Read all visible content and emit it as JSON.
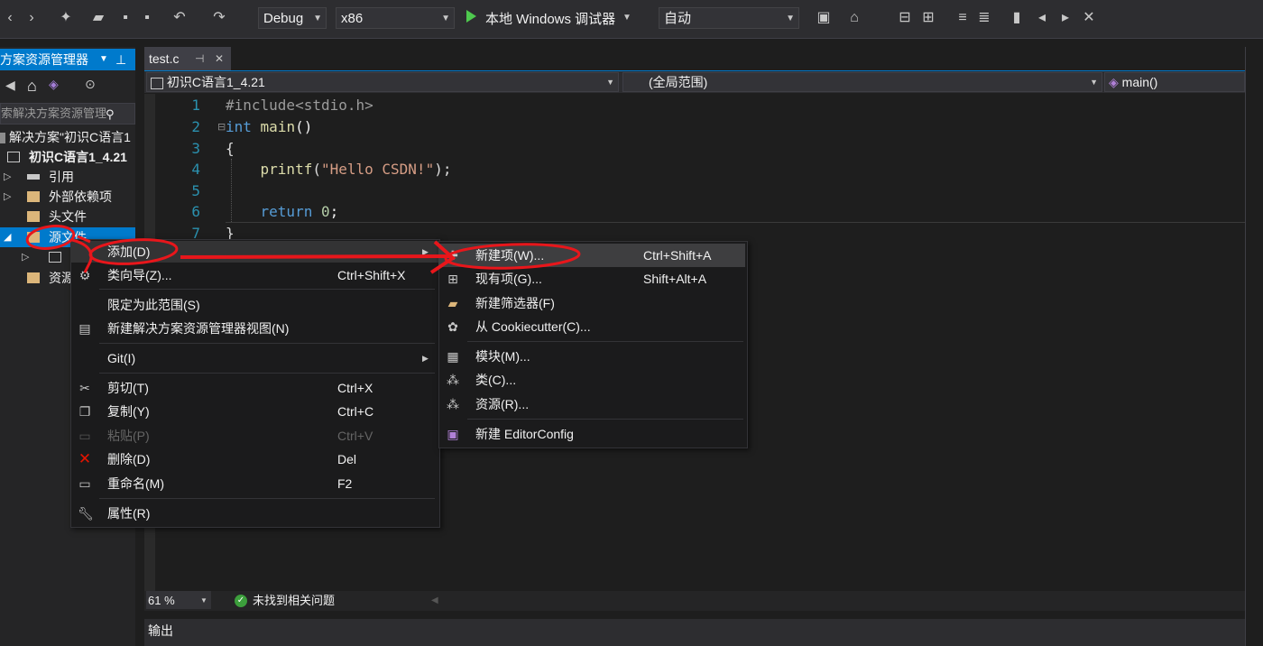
{
  "toolbar": {
    "config": "Debug",
    "platform": "x86",
    "run_label": "本地 Windows 调试器",
    "run_mode": "自动"
  },
  "solution_explorer": {
    "title": "方案资源管理器",
    "search_placeholder": "索解决方案资源管理",
    "items": [
      {
        "label": "解决方案\"初识C语言1"
      },
      {
        "label": "初识C语言1_4.21"
      },
      {
        "label": "引用"
      },
      {
        "label": "外部依赖项"
      },
      {
        "label": "头文件"
      },
      {
        "label": "源文件"
      },
      {
        "label": "资源"
      }
    ]
  },
  "editor": {
    "tab": "test.c",
    "nav_project": "初识C语言1_4.21",
    "nav_scope": "(全局范围)",
    "nav_member": "main()",
    "lines": [
      {
        "n": "1",
        "text": "#include<stdio.h>"
      },
      {
        "n": "2",
        "text": "int main()"
      },
      {
        "n": "3",
        "text": "{"
      },
      {
        "n": "4",
        "text": "    printf(\"Hello CSDN!\");"
      },
      {
        "n": "5",
        "text": ""
      },
      {
        "n": "6",
        "text": "    return 0;"
      },
      {
        "n": "7",
        "text": "}"
      }
    ],
    "zoom": "61 %",
    "status": "未找到相关问题",
    "output_tab": "输出"
  },
  "context_menu": {
    "items": [
      {
        "label": "添加(D)",
        "shortcut": ""
      },
      {
        "label": "类向导(Z)...",
        "shortcut": "Ctrl+Shift+X"
      },
      {
        "label": "限定为此范围(S)",
        "shortcut": ""
      },
      {
        "label": "新建解决方案资源管理器视图(N)",
        "shortcut": ""
      },
      {
        "label": "Git(I)",
        "shortcut": ""
      },
      {
        "label": "剪切(T)",
        "shortcut": "Ctrl+X"
      },
      {
        "label": "复制(Y)",
        "shortcut": "Ctrl+C"
      },
      {
        "label": "粘贴(P)",
        "shortcut": "Ctrl+V"
      },
      {
        "label": "删除(D)",
        "shortcut": "Del"
      },
      {
        "label": "重命名(M)",
        "shortcut": "F2"
      },
      {
        "label": "属性(R)",
        "shortcut": ""
      }
    ]
  },
  "submenu": {
    "items": [
      {
        "label": "新建项(W)...",
        "shortcut": "Ctrl+Shift+A"
      },
      {
        "label": "现有项(G)...",
        "shortcut": "Shift+Alt+A"
      },
      {
        "label": "新建筛选器(F)",
        "shortcut": ""
      },
      {
        "label": "从 Cookiecutter(C)...",
        "shortcut": ""
      },
      {
        "label": "模块(M)...",
        "shortcut": ""
      },
      {
        "label": "类(C)...",
        "shortcut": ""
      },
      {
        "label": "资源(R)...",
        "shortcut": ""
      },
      {
        "label": "新建 EditorConfig",
        "shortcut": ""
      }
    ]
  },
  "colors": {
    "accent": "#007acc",
    "annotation": "#e8161b",
    "keyword": "#569cd6",
    "string": "#d69d85",
    "preprocessor": "#9b9b9b",
    "function": "#dcdcaa",
    "number": "#b5cea8"
  }
}
